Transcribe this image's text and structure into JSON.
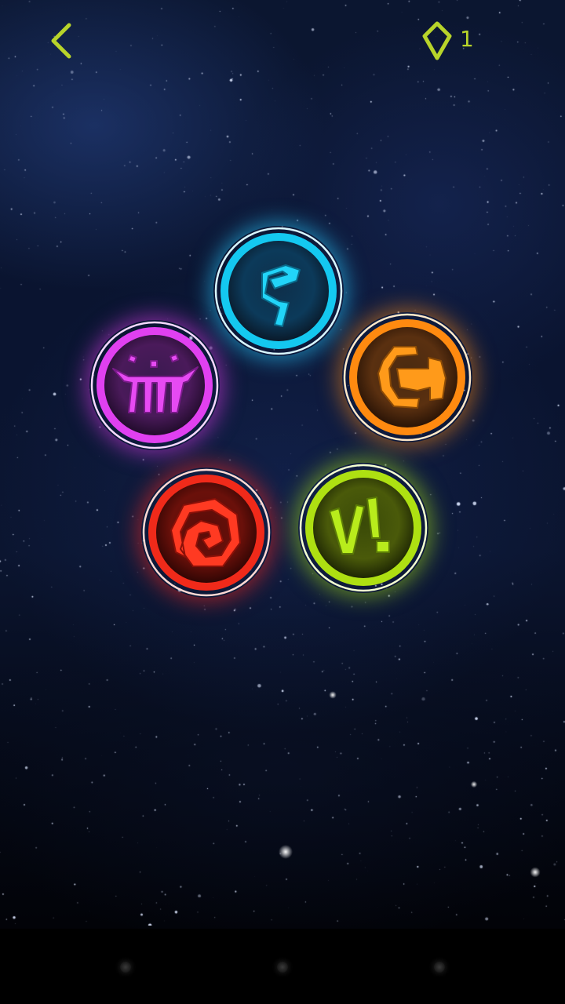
{
  "header": {
    "back_icon": "chevron-left-icon",
    "gem_icon": "gem-icon",
    "gem_count": "1",
    "accent_color": "#b8d42a"
  },
  "runes": [
    {
      "id": "cyan",
      "color": "#1fd0f5",
      "icon": "spiral-hook-glyph"
    },
    {
      "id": "purple",
      "color": "#e040f0",
      "icon": "mouth-glyph"
    },
    {
      "id": "orange",
      "color": "#ff8a10",
      "icon": "c-bar-glyph"
    },
    {
      "id": "red",
      "color": "#ff3020",
      "icon": "hexagon-spiral-glyph"
    },
    {
      "id": "lime",
      "color": "#b4e816",
      "icon": "slash-exclaim-glyph"
    }
  ],
  "nav": {
    "buttons": [
      "back-nav-button",
      "home-nav-button",
      "recents-nav-button"
    ]
  }
}
